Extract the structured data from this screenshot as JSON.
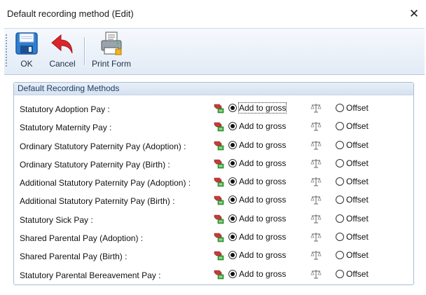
{
  "window": {
    "title": "Default recording method (Edit)",
    "close_glyph": "✕"
  },
  "toolbar": {
    "ok_label": "OK",
    "cancel_label": "Cancel",
    "print_label": "Print Form",
    "icons": {
      "ok": "save-disk-icon",
      "cancel": "undo-arrow-icon",
      "print": "print-form-icon"
    }
  },
  "group": {
    "title": "Default Recording Methods"
  },
  "options": {
    "add_to_gross": "Add to gross",
    "offset": "Offset"
  },
  "rows": [
    {
      "label": "Statutory Adoption Pay :",
      "selected": "add_to_gross",
      "focused": true
    },
    {
      "label": "Statutory Maternity Pay :",
      "selected": "add_to_gross"
    },
    {
      "label": "Ordinary Statutory Paternity Pay (Adoption) :",
      "selected": "add_to_gross"
    },
    {
      "label": "Ordinary Statutory Paternity Pay (Birth) :",
      "selected": "add_to_gross"
    },
    {
      "label": "Additional Statutory Paternity Pay (Adoption) :",
      "selected": "add_to_gross"
    },
    {
      "label": "Additional Statutory Paternity Pay (Birth) :",
      "selected": "add_to_gross"
    },
    {
      "label": "Statutory Sick Pay :",
      "selected": "add_to_gross"
    },
    {
      "label": "Shared Parental Pay (Adoption) :",
      "selected": "add_to_gross"
    },
    {
      "label": "Shared Parental Pay (Birth) :",
      "selected": "add_to_gross"
    },
    {
      "label": "Statutory Parental Bereavement Pay :",
      "selected": "add_to_gross"
    }
  ],
  "colors": {
    "toolbar_bg": "#e2ebf6",
    "group_header": "#1e3d6b",
    "disk_blue": "#2f7fd1",
    "cancel_red": "#d9262b"
  }
}
